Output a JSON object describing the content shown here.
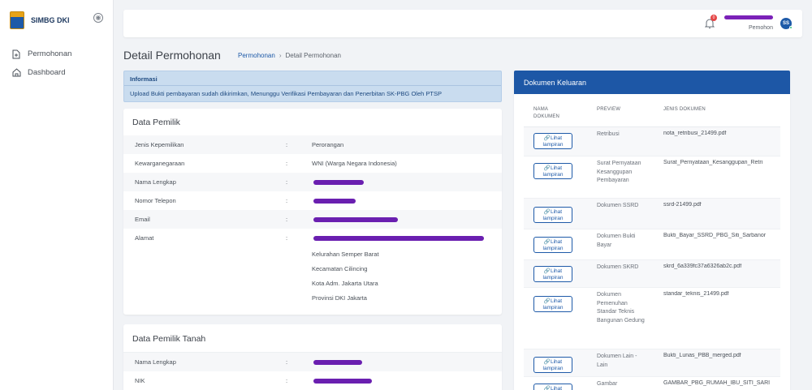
{
  "brand": {
    "name": "SIMBG DKI",
    "collapse": "◉"
  },
  "nav": [
    {
      "label": "Permohonan",
      "icon": "document-icon"
    },
    {
      "label": "Dashboard",
      "icon": "home-icon"
    }
  ],
  "topbar": {
    "notif_count": "0",
    "user_role": "Pemohon",
    "avatar_initials": "SS"
  },
  "page": {
    "title": "Detail Permohonan"
  },
  "breadcrumb": {
    "link": "Permohonan",
    "sep": "›",
    "current": "Detail Permohonan"
  },
  "alert": {
    "title": "Informasi",
    "text": "Upload Bukti pembayaran sudah dikirimkan, Menunggu Verifikasi Pembayaran dan Penerbitan SK-PBG Oleh PTSP"
  },
  "pemilik": {
    "title": "Data Pemilik",
    "colon": ":",
    "rows": [
      {
        "label": "Jenis Kepemilikan",
        "value": "Perorangan"
      },
      {
        "label": "Kewarganegaraan",
        "value": "WNI (Warga Negara Indonesia)"
      },
      {
        "label": "Nama Lengkap",
        "value": ""
      },
      {
        "label": "Nomor Telepon",
        "value": ""
      },
      {
        "label": "Email",
        "value": ""
      },
      {
        "label": "Alamat",
        "value": ""
      }
    ],
    "address": [
      "Kelurahan Semper Barat",
      "Kecamatan Cilincing",
      "Kota Adm. Jakarta Utara",
      "Provinsi DKI Jakarta"
    ]
  },
  "tanah": {
    "title": "Data Pemilik Tanah",
    "colon": ":",
    "rows": [
      {
        "label": "Nama Lengkap"
      },
      {
        "label": "NIK"
      }
    ]
  },
  "dokumen": {
    "title": "Dokumen Keluaran",
    "headers": {
      "nama": "NAMA DOKUMEN",
      "preview": "PREVIEW",
      "jenis": "JENIS DOKUMEN"
    },
    "button_label": "Lihat lampiran",
    "rows": [
      {
        "preview": "Retribusi",
        "jenis": "nota_retribusi_21499.pdf"
      },
      {
        "preview": "Surat Pernyataan Kesanggupan Pembayaran",
        "jenis": "Surat_Pernyataan_Kesanggupan_Retri"
      },
      {
        "preview": "Dokumen SSRD",
        "jenis": "ssrd-21499.pdf"
      },
      {
        "preview": "Dokumen Bukti Bayar",
        "jenis": "Bukti_Bayar_SSRD_PBG_Siti_Sarbanor"
      },
      {
        "preview": "Dokumen SKRD",
        "jenis": "skrd_6a339fc37a6326ab2c.pdf"
      },
      {
        "preview": "Dokumen Pemenuhan Standar Teknis Bangunan Gedung",
        "jenis": "standar_teknis_21499.pdf"
      },
      {
        "preview": "Dokumen Lain - Lain",
        "jenis": "Bukti_Lunas_PBB_merged.pdf"
      },
      {
        "preview": "Gambar",
        "jenis": "GAMBAR_PBG_RUMAH_IBU_SITI_SARI"
      }
    ]
  }
}
